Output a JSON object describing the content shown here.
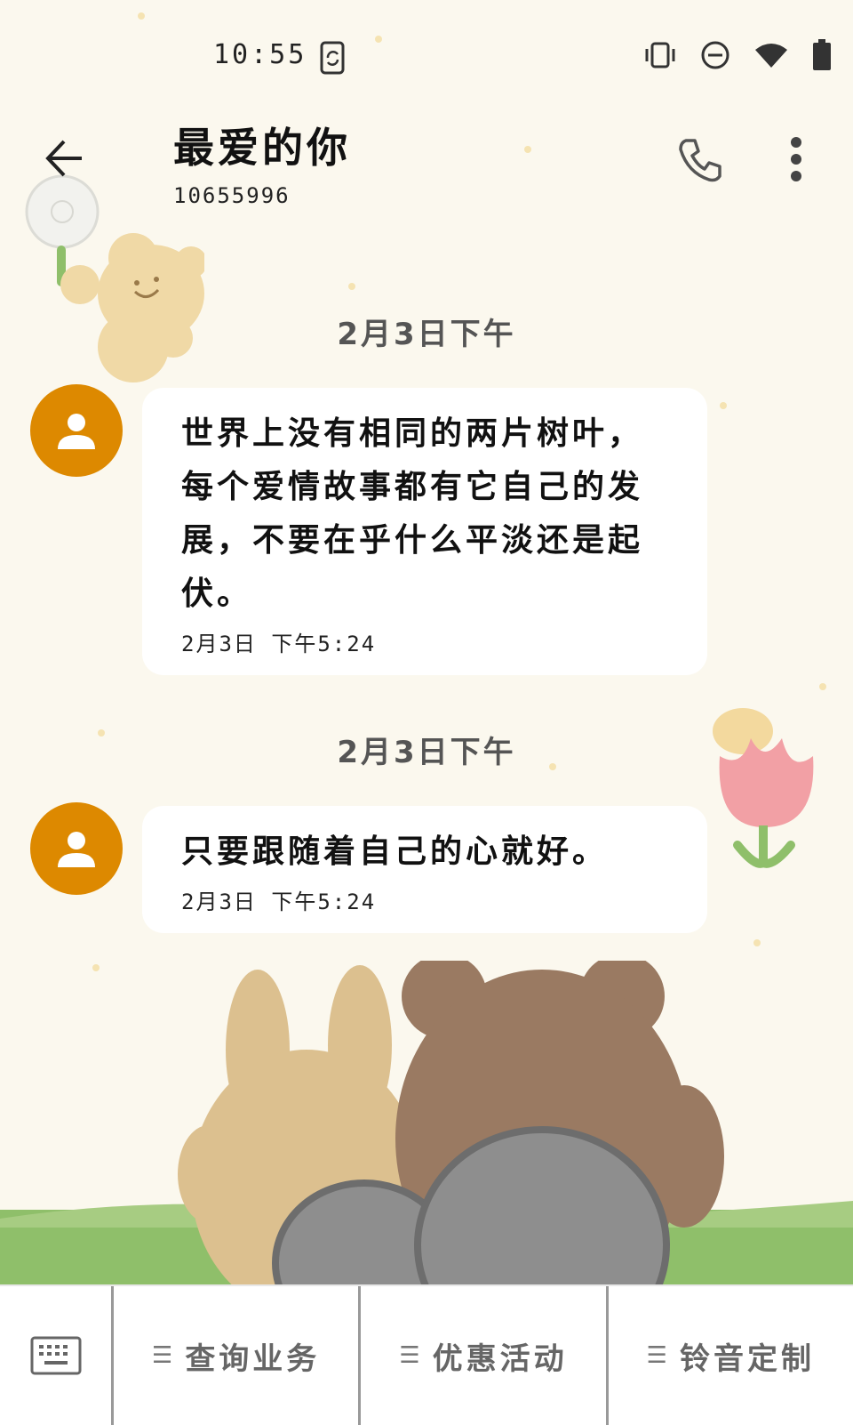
{
  "status_bar": {
    "time": "10:55",
    "icons": [
      "screen-rotate-icon",
      "vibrate-icon",
      "do-not-disturb-icon",
      "wifi-icon",
      "battery-icon"
    ]
  },
  "header": {
    "title": "最爱的你",
    "subtitle": "10655996",
    "icons": [
      "back-arrow-icon",
      "phone-icon",
      "more-vert-icon"
    ]
  },
  "conversation": {
    "groups": [
      {
        "date_label": "2月3日下午",
        "message": "世界上没有相同的两片树叶，每个爱情故事都有它自己的发展，不要在乎什么平淡还是起伏。",
        "time": "2月3日 下午5:24"
      },
      {
        "date_label": "2月3日下午",
        "message": "只要跟随着自己的心就好。",
        "time": "2月3日 下午5:24"
      }
    ]
  },
  "toolbar": {
    "keyboard_icon": "keyboard-icon",
    "menus": [
      {
        "label": "查询业务"
      },
      {
        "label": "优惠活动"
      },
      {
        "label": "铃音定制"
      }
    ]
  },
  "colors": {
    "background": "#fbf8ee",
    "avatar": "#dd8900",
    "bubble": "#ffffff"
  }
}
